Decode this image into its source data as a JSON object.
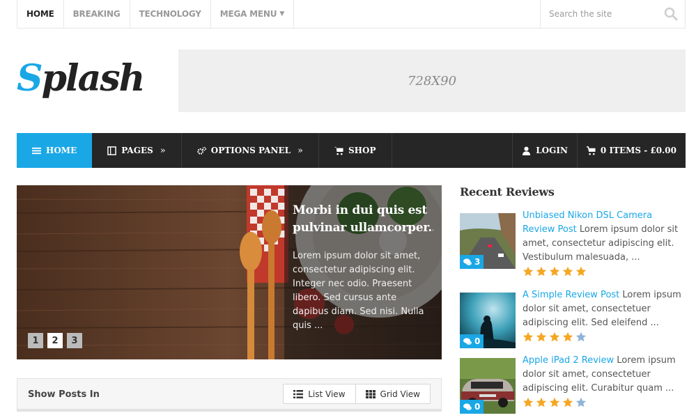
{
  "topnav": {
    "items": [
      {
        "label": "HOME",
        "active": true
      },
      {
        "label": "BREAKING",
        "active": false
      },
      {
        "label": "TECHNOLOGY",
        "active": false
      },
      {
        "label": "MEGA MENU",
        "active": false,
        "icon": "caret-down-icon"
      }
    ],
    "search_placeholder": "Search the site"
  },
  "logo": {
    "first": "S",
    "rest": "plash",
    "accent": "#1aa7e6"
  },
  "banner": {
    "text": "728X90"
  },
  "mainnav": {
    "left": [
      {
        "label": "HOME",
        "icon": "home-icon",
        "active": true
      },
      {
        "label": "PAGES",
        "icon": "document-icon",
        "submenu": "»"
      },
      {
        "label": "OPTIONS PANEL",
        "icon": "gears-icon",
        "submenu": "»"
      },
      {
        "label": "SHOP",
        "icon": "cart-icon"
      }
    ],
    "right": [
      {
        "label": "LOGIN",
        "icon": "user-icon"
      },
      {
        "label": "0 ITEMS - £0.00",
        "icon": "cart-icon"
      }
    ]
  },
  "slider": {
    "title_line1": "Morbi in dui quis est",
    "title_line2": "pulvinar ullamcorper...",
    "excerpt": "Lorem ipsum dolor sit amet, consectetur adipiscing elit. Integer nec odio. Praesent libero. Sed cursus ante dapibus diam. Sed nisi. Nulla quis ...",
    "pages": [
      "1",
      "2",
      "3"
    ],
    "current_page": "2"
  },
  "posts_bar": {
    "label": "Show Posts In",
    "list_view": "List View",
    "grid_view": "Grid View"
  },
  "recent_reviews": {
    "title": "Recent Reviews",
    "items": [
      {
        "title": "Unbiased Nikon DSL Camera Review Post",
        "excerpt": " Lorem ipsum dolor sit amet, consectetur adipiscing elit. Vestibulum malesuada, ...",
        "comments": "3",
        "rating": 5
      },
      {
        "title": "A Simple Review Post",
        "excerpt": " Lorem ipsum dolor sit amet, consectetuer adipiscing elit. Sed eleifend ...",
        "comments": "0",
        "rating": 4
      },
      {
        "title": "Apple iPad 2 Review",
        "excerpt": " Lorem ipsum dolor sit amet, consectetuer adipiscing elit. Curabitur quam ...",
        "comments": "0",
        "rating": 4
      }
    ]
  },
  "colors": {
    "accent": "#1aa7e6",
    "star_on": "#f5a623",
    "star_off": "#8fb3d9",
    "nav_bg": "#262626"
  }
}
